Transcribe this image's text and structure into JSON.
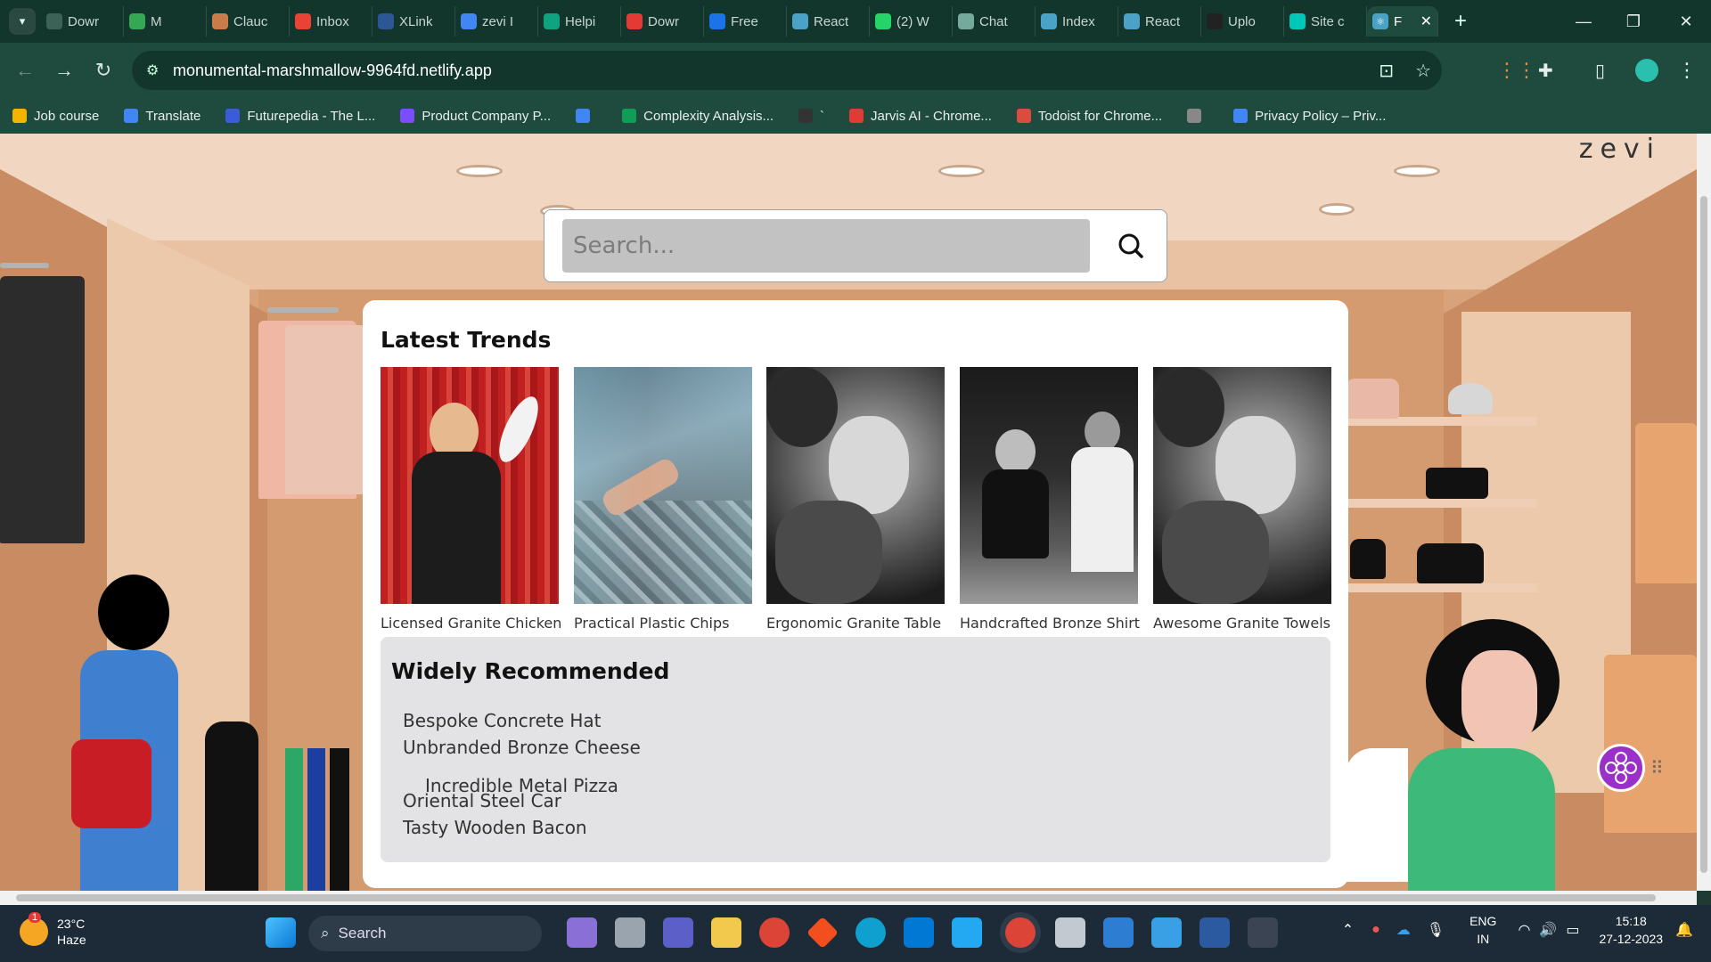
{
  "browser": {
    "tabs": [
      {
        "label": "Dowr",
        "icon": "download-icon",
        "color": "#3c6156"
      },
      {
        "label": "M",
        "icon": "meet-icon",
        "color": "#34a853"
      },
      {
        "label": "Clauc",
        "icon": "claude-icon",
        "color": "#c97b4a"
      },
      {
        "label": "Inbox",
        "icon": "gmail-icon",
        "color": "#ea4335"
      },
      {
        "label": "XLink",
        "icon": "word-icon",
        "color": "#2b5797"
      },
      {
        "label": "zevi I",
        "icon": "google-icon",
        "color": "#4285f4"
      },
      {
        "label": "Helpi",
        "icon": "chatgpt-icon",
        "color": "#10a37f"
      },
      {
        "label": "Dowr",
        "icon": "opera-icon",
        "color": "#e53935"
      },
      {
        "label": "Free",
        "icon": "forms-icon",
        "color": "#1a73e8"
      },
      {
        "label": "React",
        "icon": "react-icon",
        "color": "#4aa3c7"
      },
      {
        "label": "(2) W",
        "icon": "whatsapp-icon",
        "color": "#25d366"
      },
      {
        "label": "Chat",
        "icon": "chatgpt-icon",
        "color": "#74aa9c"
      },
      {
        "label": "Index",
        "icon": "react-icon",
        "color": "#4aa3c7"
      },
      {
        "label": "React",
        "icon": "react-icon",
        "color": "#4aa3c7"
      },
      {
        "label": "Uplo",
        "icon": "github-icon",
        "color": "#222222"
      },
      {
        "label": "Site c",
        "icon": "netlify-icon",
        "color": "#00c7b7"
      }
    ],
    "active_tab": {
      "label": "F",
      "icon": "react-icon"
    },
    "url": "monumental-marshmallow-9964fd.netlify.app",
    "bookmarks": [
      {
        "label": "Job course",
        "color": "#f4b400"
      },
      {
        "label": "Translate",
        "color": "#4285f4"
      },
      {
        "label": "Futurepedia - The L...",
        "color": "#3b5bdb"
      },
      {
        "label": "Product Company P...",
        "color": "#7c4dff"
      },
      {
        "label": "",
        "color": "#4285f4"
      },
      {
        "label": "Complexity Analysis...",
        "color": "#0f9d58"
      },
      {
        "label": "`",
        "color": "#333333"
      },
      {
        "label": "Jarvis AI - Chrome...",
        "color": "#e53935"
      },
      {
        "label": "Todoist for Chrome...",
        "color": "#db4c3f"
      },
      {
        "label": "",
        "color": "#888888"
      },
      {
        "label": "Privacy Policy – Priv...",
        "color": "#4285f4"
      }
    ]
  },
  "site": {
    "brand": "zevi",
    "search": {
      "placeholder": "Search..."
    },
    "latest_trends": {
      "title": "Latest Trends",
      "items": [
        {
          "name": "Licensed Granite Chicken"
        },
        {
          "name": "Practical Plastic Chips"
        },
        {
          "name": "Ergonomic Granite Table"
        },
        {
          "name": "Handcrafted Bronze Shirt"
        },
        {
          "name": "Awesome Granite Towels"
        }
      ]
    },
    "widely_recommended": {
      "title": "Widely Recommended",
      "items": [
        "Bespoke Concrete Hat",
        "Unbranded Bronze Cheese",
        "Incredible Metal Pizza",
        "Oriental Steel Car",
        "Tasty Wooden Bacon"
      ]
    }
  },
  "taskbar": {
    "weather": {
      "temp": "23°C",
      "condition": "Haze",
      "badge": "1"
    },
    "search_label": "Search",
    "lang_top": "ENG",
    "lang_bottom": "IN",
    "time": "15:18",
    "date": "27-12-2023"
  }
}
